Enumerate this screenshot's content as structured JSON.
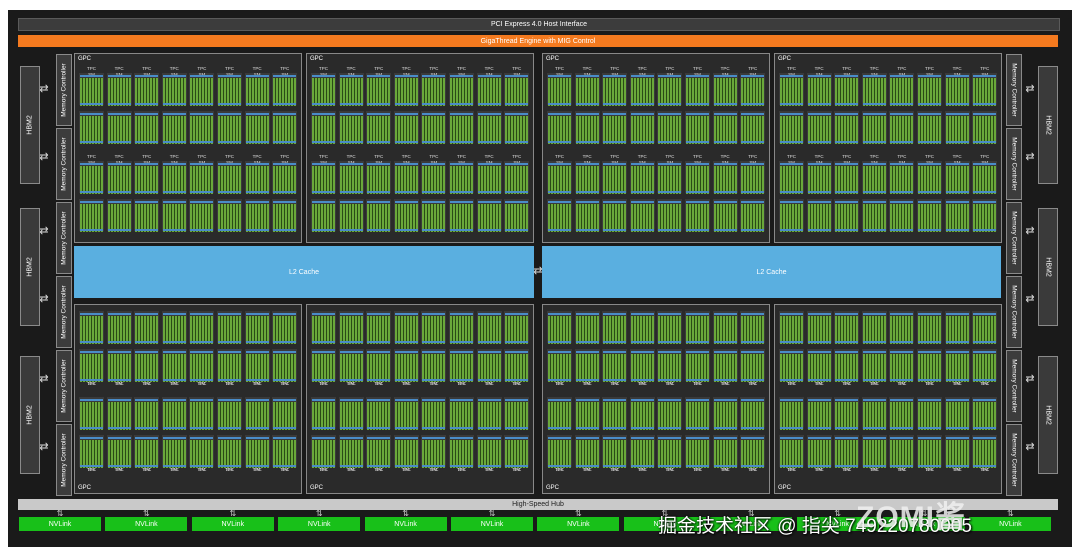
{
  "pcie_label": "PCI Express 4.0 Host Interface",
  "giga_label": "GigaThread Engine with MIG Control",
  "hub_label": "High-Speed Hub",
  "l2_label": "L2 Cache",
  "gpc_label": "GPC",
  "tpc_label": "TPC",
  "sm_label": "SM",
  "hbm_label": "HBM2",
  "mc_label": "Memory Controller",
  "nvlink_label": "NVLink",
  "watermark": "掘金技术社区 @ 指尖 749220780005",
  "logo": "ZOMI酱"
}
